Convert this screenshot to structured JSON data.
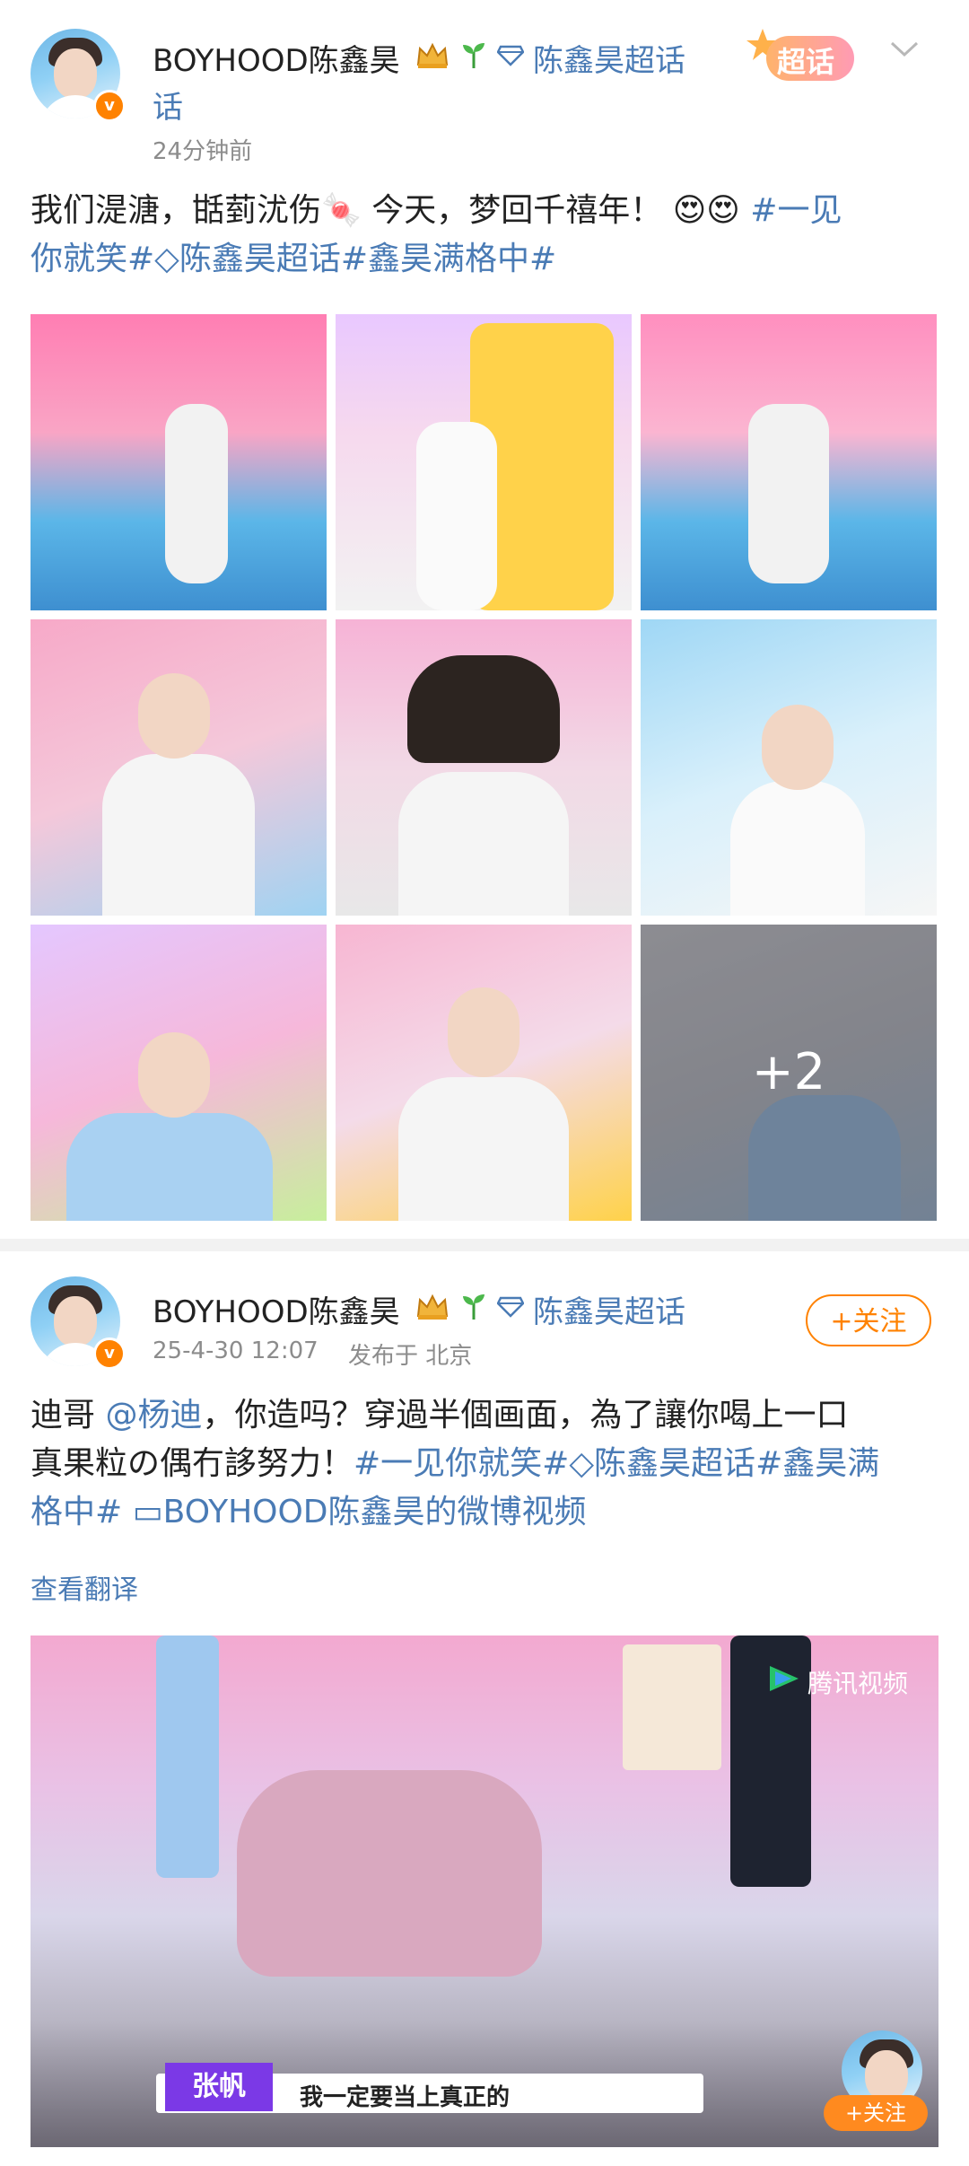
{
  "post1": {
    "username": "BOYHOOD陈鑫昊",
    "topic": "陈鑫昊超话",
    "time": "24分钟前",
    "text_plain": "我们湜溏，甛菿沋伤",
    "text_plain2": "今天，梦回千禧年！",
    "hashtag1": "#一见",
    "hashtag1b": "你就笑#",
    "hashtag2": "陈鑫昊超话",
    "hashtag3": "#鑫昊满格中#",
    "super_badge": "超话",
    "more_count": "+2"
  },
  "post2": {
    "username": "BOYHOOD陈鑫昊",
    "topic": "陈鑫昊超话",
    "date": "25-4-30 12:07",
    "location": "发布于 北京",
    "follow_label": "+关注",
    "line1_a": "迪哥",
    "mention": "@杨迪",
    "line1_b": "，你造吗？穿過半個画面，為了讓你喝上一口",
    "line2_a": "真果粒の偶冇誃努力！",
    "line2_tag1": "#一见你就笑#",
    "line2_tag2": "陈鑫昊超话",
    "line2_tag3": "#鑫昊满",
    "line3_tag": "格中#",
    "video_link": "BOYHOOD陈鑫昊的微博视频",
    "translate": "查看翻译",
    "video_logo": "腾讯视频",
    "caption_name": "张帆",
    "caption_text": "我一定要当上真正的",
    "corner_follow": "+关注"
  }
}
